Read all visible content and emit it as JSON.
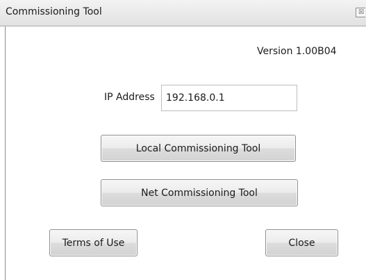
{
  "window": {
    "title": "Commissioning Tool",
    "close_glyph": "☒"
  },
  "version_text": "Version 1.00B04",
  "ip": {
    "label": "IP Address",
    "value": "192.168.0.1"
  },
  "buttons": {
    "local": "Local Commissioning Tool",
    "net": "Net Commissioning Tool",
    "terms": "Terms of Use",
    "close": "Close"
  }
}
